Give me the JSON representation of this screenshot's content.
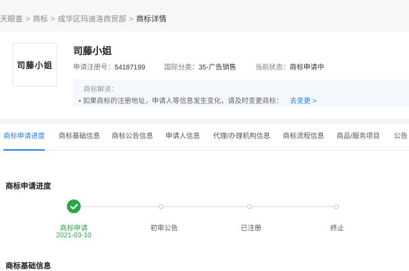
{
  "breadcrumb": {
    "items": [
      "天眼查",
      "商标",
      "成华区玛迪洛商贸部"
    ],
    "current": "商标详情"
  },
  "trademark": {
    "logo_text": "司藤小姐",
    "name": "司藤小姐",
    "reg_no_label": "申请注册号：",
    "reg_no": "54187199",
    "intl_class_label": "国际分类：",
    "intl_class": "35-广告销售",
    "status_label": "当前状态：",
    "status": "商标申请中"
  },
  "notice": {
    "title": "商标解读：",
    "body": "• 如果商标的注册地址，申请人等信息发生变化，请及时变更商标：",
    "link": "去变更 >"
  },
  "tabs": [
    "商标申请进度",
    "商标基础信息",
    "商标公告信息",
    "申请人信息",
    "代理/办理机构信息",
    "商标流程信息",
    "商品/服务项目",
    "公告"
  ],
  "active_tab": 0,
  "progress": {
    "title": "商标申请进度",
    "steps": [
      {
        "label": "商标申请",
        "date": "2021-03-10"
      },
      {
        "label": "初审公告"
      },
      {
        "label": "已注册"
      },
      {
        "label": "终止"
      }
    ]
  },
  "next_section": {
    "title": "商标基础信息"
  }
}
